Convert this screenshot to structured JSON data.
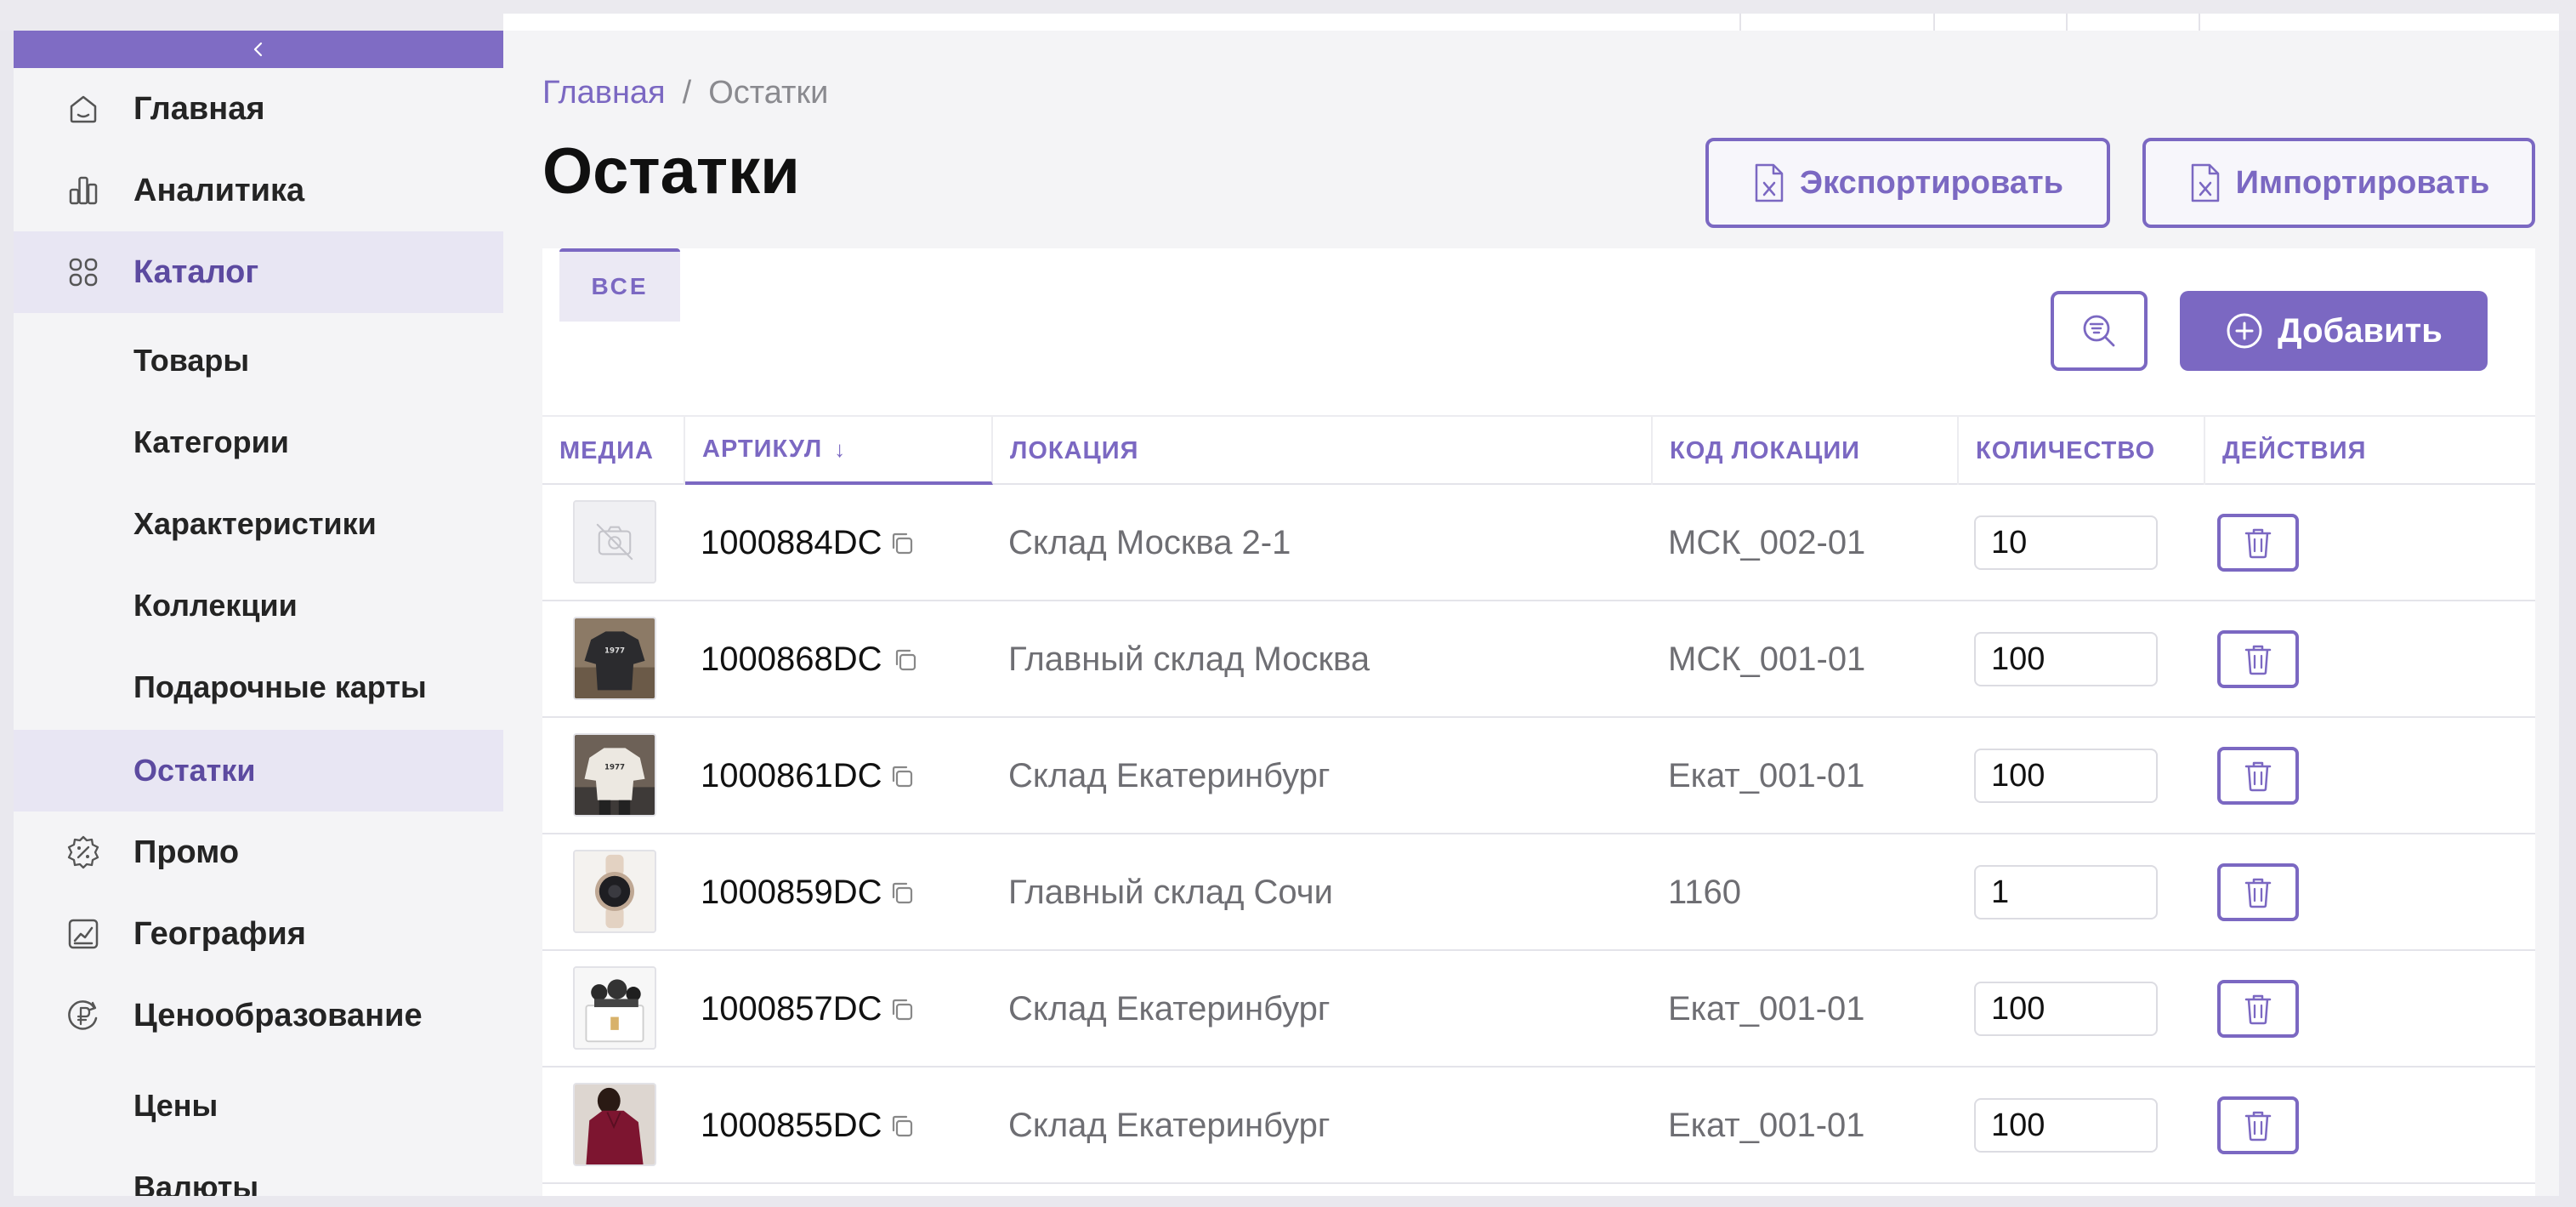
{
  "sidebar": {
    "collapse_label": "‹",
    "items": [
      {
        "label": "Главная",
        "icon": "home-icon"
      },
      {
        "label": "Аналитика",
        "icon": "analytics-icon"
      },
      {
        "label": "Каталог",
        "icon": "catalog-icon",
        "active": true
      },
      {
        "label": "Товары"
      },
      {
        "label": "Категории"
      },
      {
        "label": "Характеристики"
      },
      {
        "label": "Коллекции"
      },
      {
        "label": "Подарочные карты"
      },
      {
        "label": "Остатки",
        "active": true
      },
      {
        "label": "Промо",
        "icon": "promo-icon"
      },
      {
        "label": "География",
        "icon": "geography-icon"
      },
      {
        "label": "Ценообразование",
        "icon": "pricing-icon"
      },
      {
        "label": "Цены"
      },
      {
        "label": "Валюты"
      }
    ]
  },
  "breadcrumb": {
    "home": "Главная",
    "separator": "/",
    "current": "Остатки"
  },
  "page": {
    "title": "Остатки",
    "export_label": "Экспортировать",
    "import_label": "Импортировать"
  },
  "toolbar": {
    "tab_all": "ВСЕ",
    "add_label": "Добавить"
  },
  "table": {
    "columns": [
      "МЕДИА",
      "АРТИКУЛ",
      "ЛОКАЦИЯ",
      "КОД ЛОКАЦИИ",
      "КОЛИЧЕСТВО",
      "ДЕЙСТВИЯ"
    ],
    "sort_indicator": "↓",
    "rows": [
      {
        "sku": "1000884DC",
        "location": "Склад Москва 2-1",
        "code": "МСК_002-01",
        "qty": "10",
        "media": "no-image-icon"
      },
      {
        "sku": "1000868DC",
        "location": "Главный склад Москва",
        "code": "МСК_001-01",
        "qty": "100",
        "media": "dark-tshirt-photo"
      },
      {
        "sku": "1000861DC",
        "location": "Склад Екатеринбург",
        "code": "Екат_001-01",
        "qty": "100",
        "media": "white-tshirt-photo"
      },
      {
        "sku": "1000859DC",
        "location": "Главный склад Сочи",
        "code": "1160",
        "qty": "1",
        "media": "smartwatch-photo"
      },
      {
        "sku": "1000857DC",
        "location": "Склад Екатеринбург",
        "code": "Екат_001-01",
        "qty": "100",
        "media": "gift-box-photo"
      },
      {
        "sku": "1000855DC",
        "location": "Склад Екатеринбург",
        "code": "Екат_001-01",
        "qty": "100",
        "media": "burgundy-blouse-photo"
      }
    ]
  },
  "colors": {
    "accent": "#7b68c2",
    "active_bg": "#e8e6f3",
    "background": "#f4f4f6"
  }
}
